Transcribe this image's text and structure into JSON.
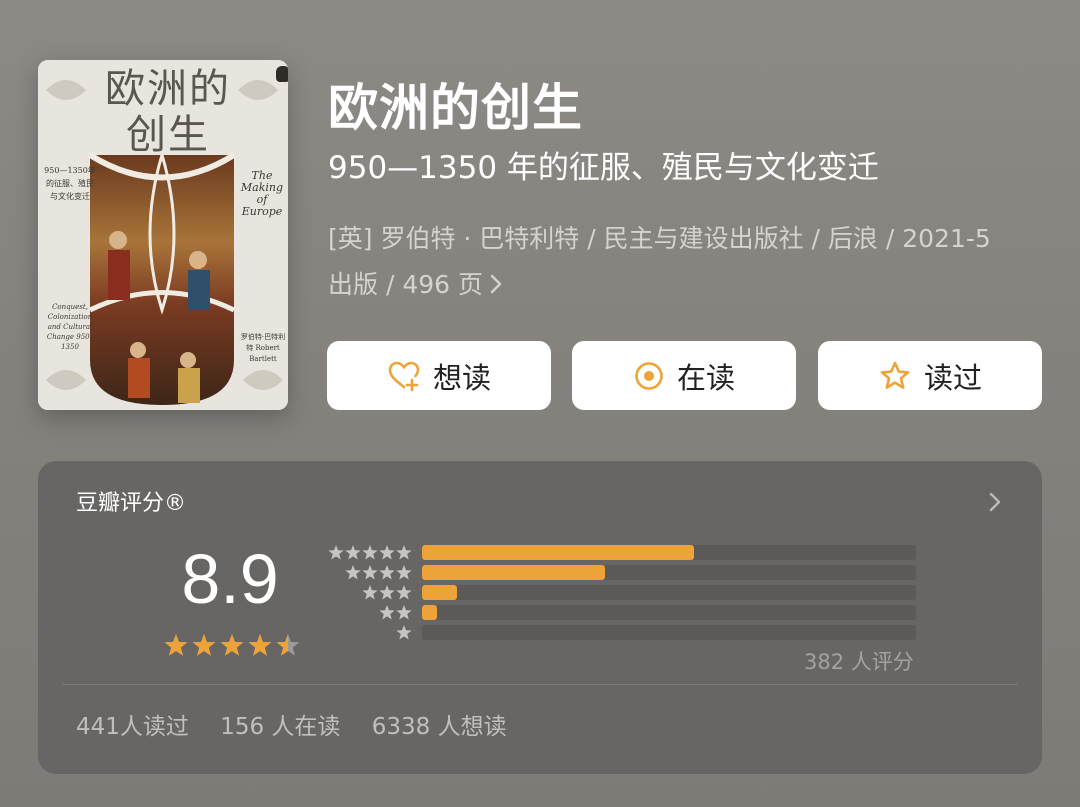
{
  "cover": {
    "title": "欧洲的创生",
    "side_text": "950—1350年的征服、殖民与文化变迁",
    "english_title": "The Making of Europe",
    "english_subtitle": "Conquest, Colonization and Cultural Change 950–1350",
    "author": "罗伯特·巴特利特 Robert Bartlett"
  },
  "book": {
    "title": "欧洲的创生",
    "subtitle": "950—1350 年的征服、殖民与文化变迁",
    "meta_line1": "[英] 罗伯特 · 巴特利特 / 民主与建设出版社 / 后浪 / 2021-5",
    "meta_line2": "出版 / 496 页"
  },
  "buttons": {
    "want_read": "想读",
    "reading": "在读",
    "have_read": "读过"
  },
  "rating": {
    "header": "豆瓣评分®",
    "score": "8.9",
    "score_stars": 4.5,
    "count_label": "382 人评分",
    "stats": {
      "read": "441人读过",
      "reading": "156 人在读",
      "want": "6338 人想读"
    }
  },
  "colors": {
    "accent": "#eea338",
    "panel": "#686664",
    "track": "#5c5a58"
  },
  "chart_data": {
    "type": "bar",
    "categories": [
      "5 stars",
      "4 stars",
      "3 stars",
      "2 stars",
      "1 star"
    ],
    "values": [
      55,
      37,
      7,
      3,
      0
    ],
    "ylim": [
      0,
      100
    ]
  }
}
